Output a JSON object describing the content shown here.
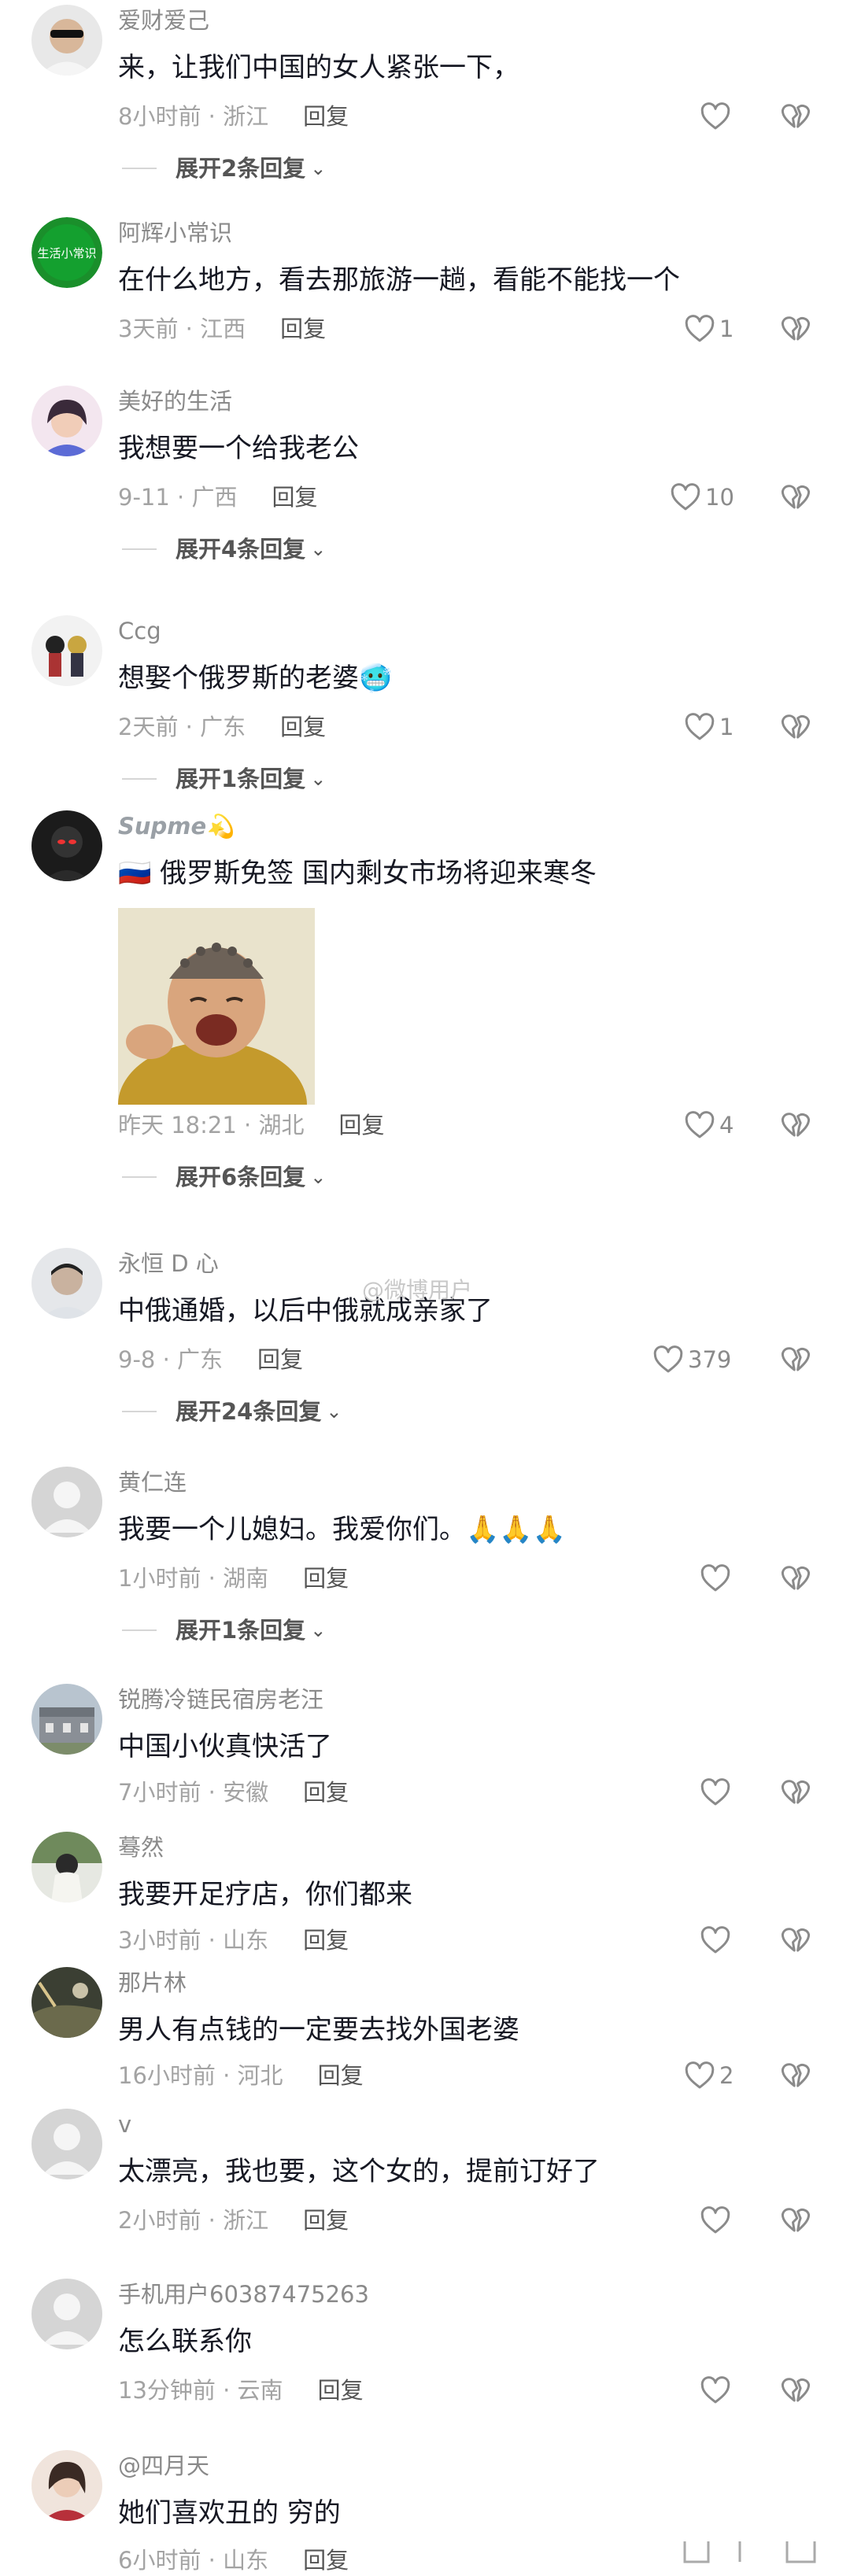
{
  "comments": [
    {
      "user": "爱财爱己",
      "text": "来，让我们中国的女人紧张一下，",
      "time": "8小时前 · 浙江",
      "reply": "回复",
      "likes": "",
      "expand": "展开2条回复"
    },
    {
      "user": "阿辉小常识",
      "avatar_text": "生活小常识",
      "text": "在什么地方，看去那旅游一趟，看能不能找一个",
      "time": "3天前 · 江西",
      "reply": "回复",
      "likes": "1"
    },
    {
      "user": "美好的生活",
      "text": "我想要一个给我老公",
      "time": "9-11 · 广西",
      "reply": "回复",
      "likes": "10",
      "expand": "展开4条回复"
    },
    {
      "user": "Ccg",
      "text": "想娶个俄罗斯的老婆",
      "emoji": "🥶",
      "time": "2天前 · 广东",
      "reply": "回复",
      "likes": "1",
      "expand": "展开1条回复"
    },
    {
      "user": "Supme",
      "user_emoji": "💫",
      "text": "🇷🇺 俄罗斯免签 国内剩女市场将迎来寒冬",
      "time": "昨天 18:21 · 湖北",
      "reply": "回复",
      "likes": "4",
      "expand": "展开6条回复"
    },
    {
      "user": "永恒 D 心",
      "text": "中俄通婚，以后中俄就成亲家了",
      "time": "9-8 · 广东",
      "reply": "回复",
      "likes": "379",
      "expand": "展开24条回复"
    },
    {
      "user": "黄仁连",
      "text": "我要一个儿媳妇。我爱你们。",
      "emoji": "🙏🙏🙏",
      "time": "1小时前 · 湖南",
      "reply": "回复",
      "likes": "",
      "expand": "展开1条回复"
    },
    {
      "user": "锐腾冷链民宿房老汪",
      "text": "中国小伙真快活了",
      "time": "7小时前 · 安徽",
      "reply": "回复",
      "likes": ""
    },
    {
      "user": "蓦然",
      "text": "我要开足疗店，你们都来",
      "time": "3小时前 · 山东",
      "reply": "回复",
      "likes": ""
    },
    {
      "user": "那片林",
      "text": "男人有点钱的一定要去找外国老婆",
      "time": "16小时前 · 河北",
      "reply": "回复",
      "likes": "2"
    },
    {
      "user": "v",
      "text": "太漂亮，我也要，这个女的，提前订好了",
      "time": "2小时前 · 浙江",
      "reply": "回复",
      "likes": ""
    },
    {
      "user": "手机用户60387475263",
      "text": "怎么联系你",
      "time": "13分钟前 · 云南",
      "reply": "回复",
      "likes": ""
    },
    {
      "user": "@四月天",
      "text": "她们喜欢丑的 穷的",
      "time": "6小时前 · 山东",
      "reply": "回复",
      "likes": ""
    }
  ],
  "watermark": "@微博用户",
  "colors": {
    "text": "#161823",
    "meta": "#a3a3a3",
    "icon": "#8a8a8a"
  }
}
